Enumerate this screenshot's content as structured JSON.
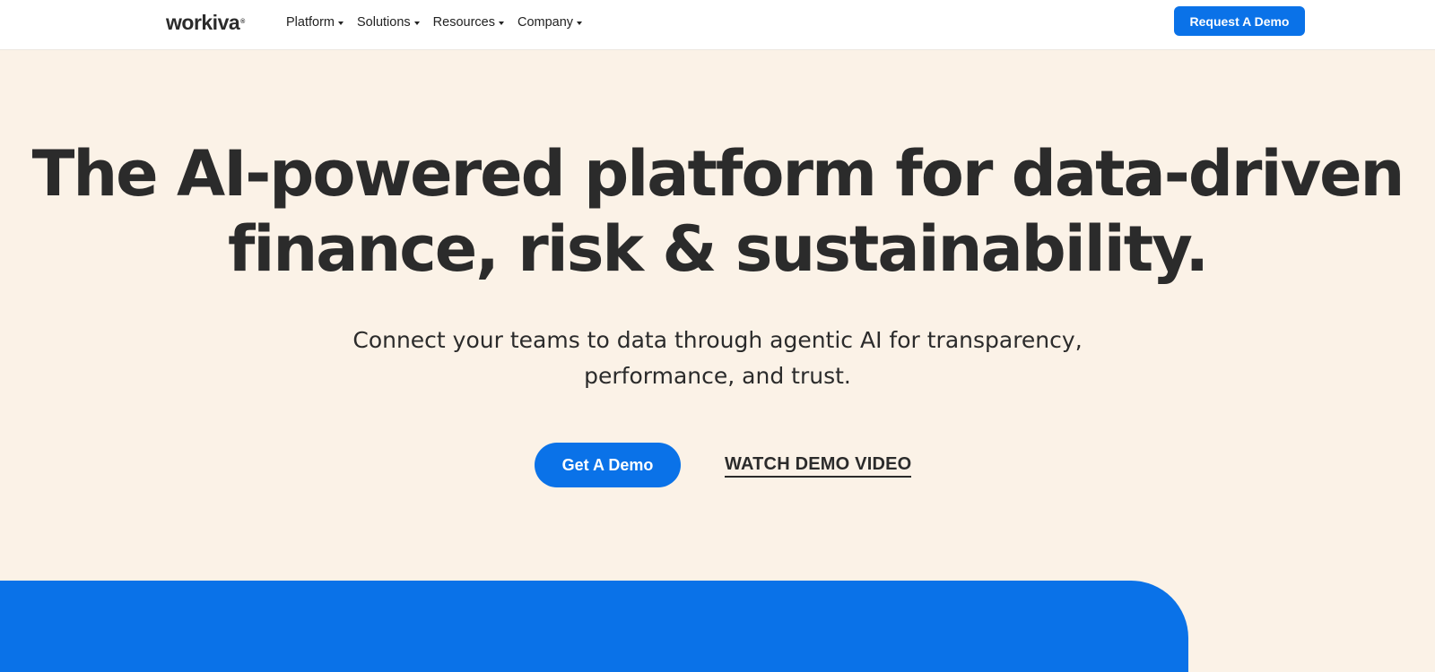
{
  "header": {
    "logo_text": "workiva",
    "logo_tm": "®",
    "nav": [
      {
        "label": "Platform"
      },
      {
        "label": "Solutions"
      },
      {
        "label": "Resources"
      },
      {
        "label": "Company"
      }
    ],
    "request_demo_label": "Request A Demo"
  },
  "hero": {
    "title_line1": "The AI-powered platform for data-driven",
    "title_line2": "finance, risk & sustainability.",
    "subtitle_line1": "Connect your teams to data through agentic AI for transparency,",
    "subtitle_line2": "performance, and trust.",
    "primary_cta": "Get A Demo",
    "secondary_cta": "WATCH DEMO VIDEO"
  },
  "colors": {
    "brand_blue": "#0a72e8",
    "hero_background": "#fbf2e7",
    "text_dark": "#2b2b2b"
  }
}
